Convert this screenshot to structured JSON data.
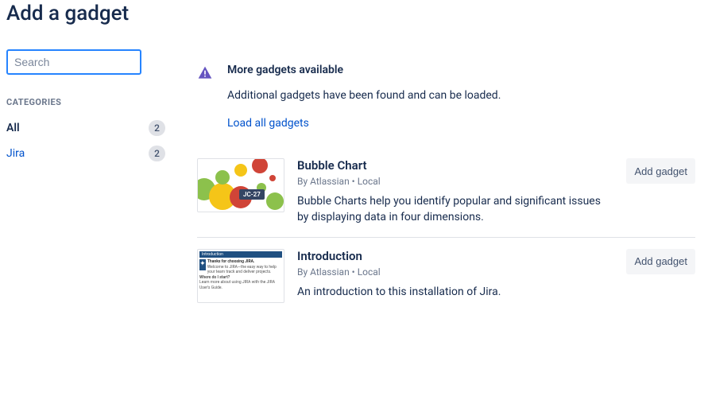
{
  "title": "Add a gadget",
  "search": {
    "placeholder": "Search",
    "value": ""
  },
  "categories": {
    "heading": "CATEGORIES",
    "items": [
      {
        "label": "All",
        "count": "2",
        "active": true
      },
      {
        "label": "Jira",
        "count": "2",
        "active": false
      }
    ]
  },
  "banner": {
    "title": "More gadgets available",
    "text": "Additional gadgets have been found and can be loaded.",
    "link": "Load all gadgets"
  },
  "gadgets": [
    {
      "title": "Bubble Chart",
      "meta": "By Atlassian • Local",
      "desc": "Bubble Charts help you identify popular and significant issues by displaying data in four dimensions.",
      "button": "Add gadget",
      "thumb_tag": "JC-27"
    },
    {
      "title": "Introduction",
      "meta": "By Atlassian • Local",
      "desc": "An introduction to this installation of Jira.",
      "button": "Add gadget",
      "thumb_bar": "Introduction",
      "thumb_h1": "Thanks for choosing JIRA.",
      "thumb_t1": "Welcome to JIRA—the easy way to help your team track and deliver projects.",
      "thumb_h2": "Where do I start?",
      "thumb_t2": "Learn more about using JIRA with the JIRA User's Guide."
    }
  ]
}
